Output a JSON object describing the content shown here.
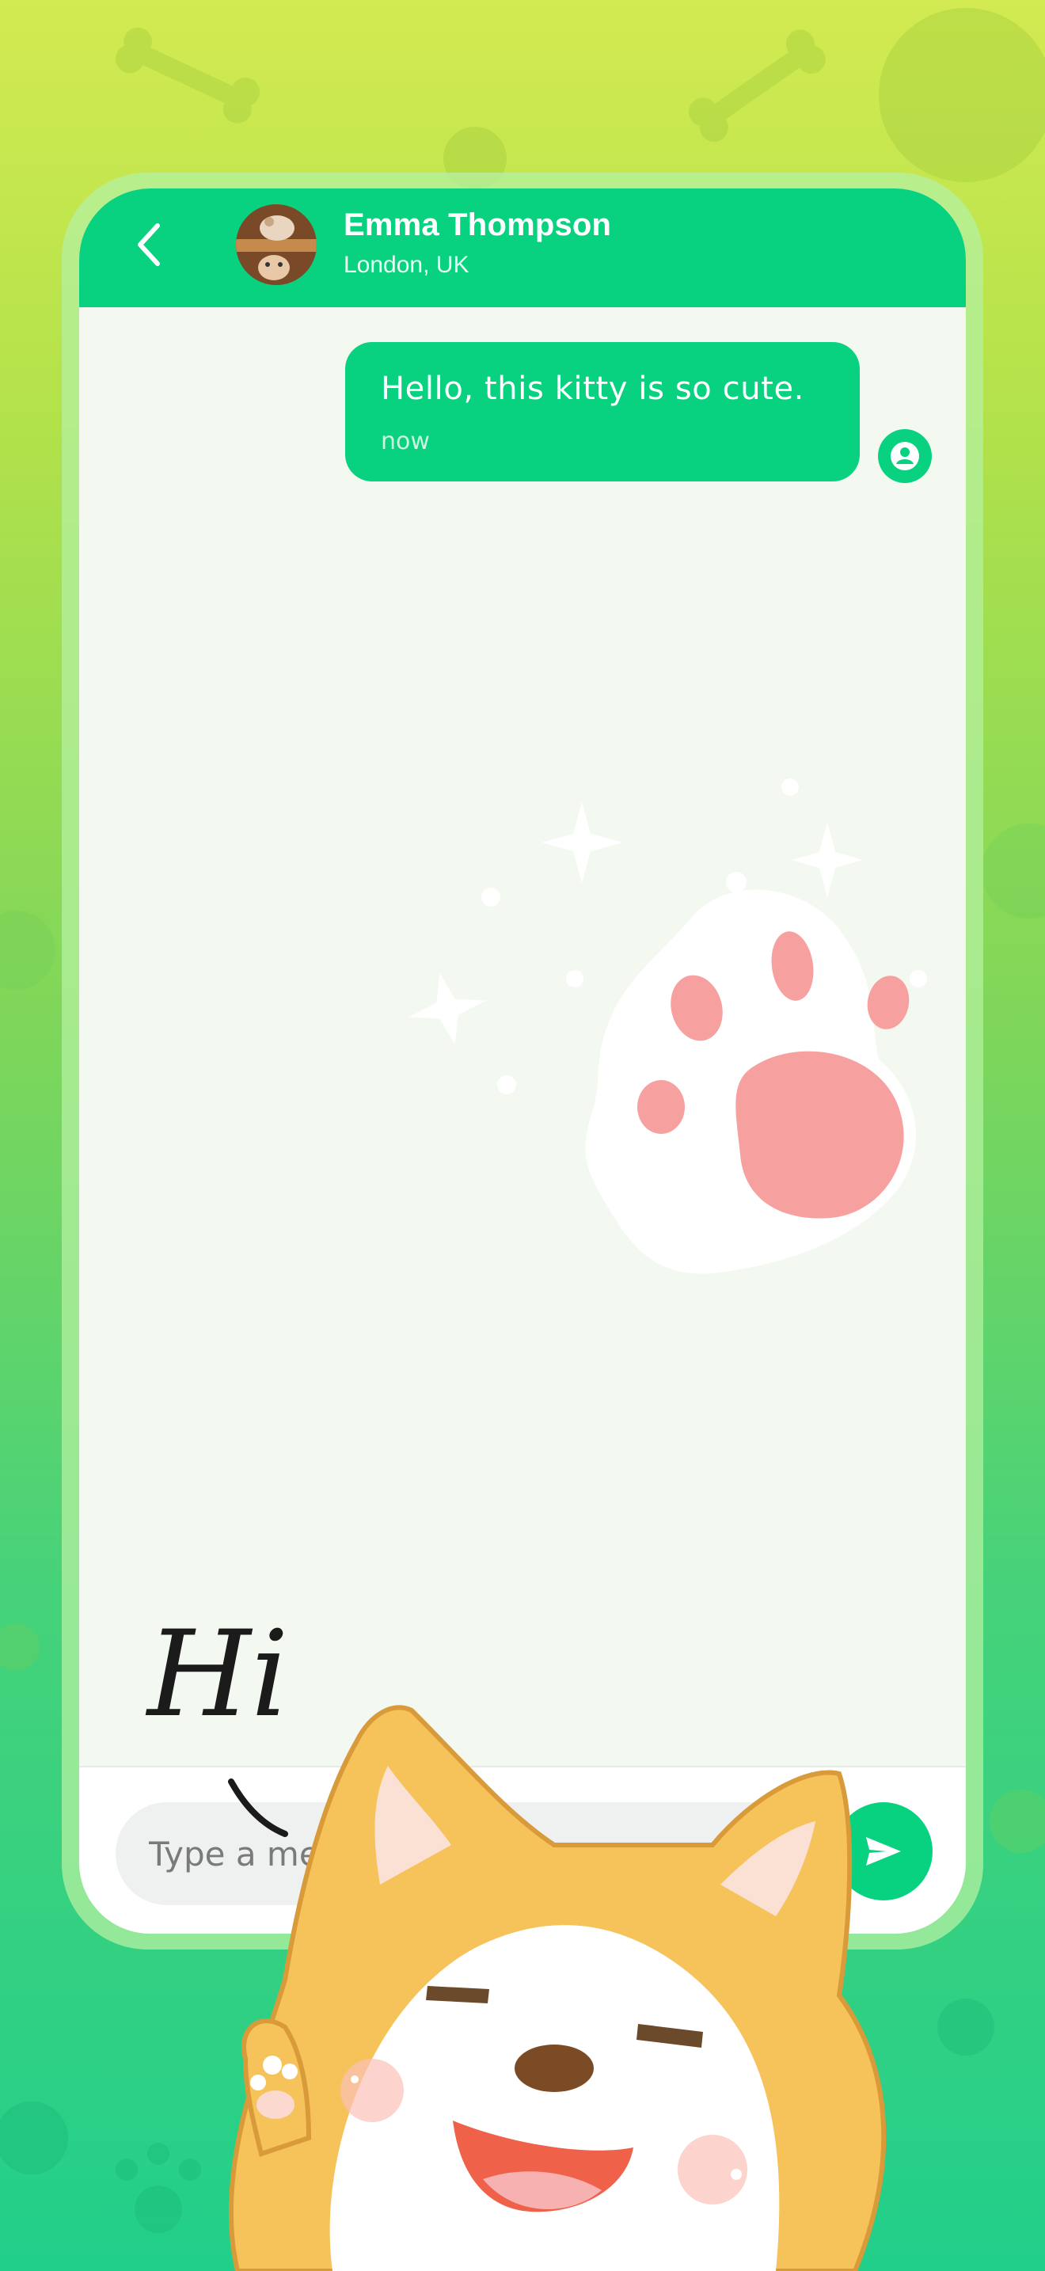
{
  "header": {
    "back_icon": "chevron-left-icon",
    "contact_name": "Emma Thompson",
    "contact_location": "London, UK"
  },
  "messages": [
    {
      "text": "Hello, this kitty is so cute.",
      "time": "now",
      "sender_icon": "user-icon"
    }
  ],
  "composer": {
    "placeholder": "Type a message",
    "send_icon": "send-icon"
  },
  "sticker": {
    "greeting": "Hi"
  },
  "colors": {
    "accent": "#08d180",
    "chat_background": "#f3f9f0",
    "paw_pad": "#f7a0a0"
  }
}
